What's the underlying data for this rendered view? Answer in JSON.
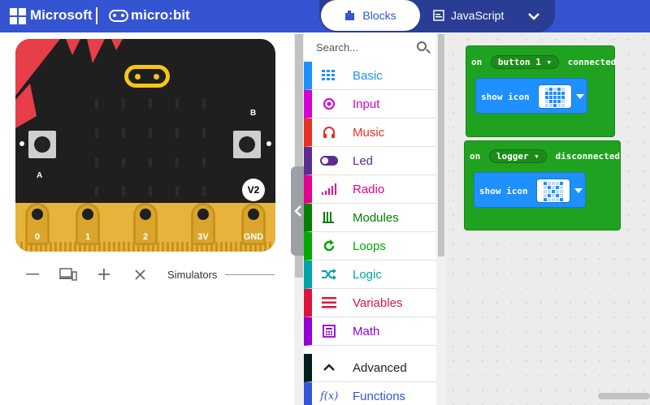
{
  "header": {
    "brand": "Microsoft",
    "product": "micro:bit",
    "tabs": {
      "blocks": "Blocks",
      "javascript": "JavaScript"
    }
  },
  "simulator": {
    "pins": [
      "0",
      "1",
      "2",
      "3V",
      "GND"
    ],
    "button_a": "A",
    "button_b": "B",
    "version_badge": "V2",
    "label": "Simulators"
  },
  "toolbox": {
    "search_placeholder": "Search...",
    "categories": [
      {
        "label": "Basic",
        "color": "#1E90FF",
        "icon": "grid-icon"
      },
      {
        "label": "Input",
        "color": "#D400D4",
        "icon": "target-icon"
      },
      {
        "label": "Music",
        "color": "#E63022",
        "icon": "headphones-icon"
      },
      {
        "label": "Led",
        "color": "#5C2D91",
        "icon": "toggle-icon"
      },
      {
        "label": "Radio",
        "color": "#E3008C",
        "icon": "signal-icon"
      },
      {
        "label": "Modules",
        "color": "#008000",
        "icon": "modules-icon"
      },
      {
        "label": "Loops",
        "color": "#00AA00",
        "icon": "loop-icon"
      },
      {
        "label": "Logic",
        "color": "#00A4A6",
        "icon": "shuffle-icon"
      },
      {
        "label": "Variables",
        "color": "#DC143C",
        "icon": "list-icon"
      },
      {
        "label": "Math",
        "color": "#9400D3",
        "icon": "calculator-icon"
      },
      {
        "label": "Advanced",
        "color": "#001E1E",
        "icon": "chevron-up-icon"
      },
      {
        "label": "Functions",
        "color": "#3455DB",
        "icon": "function-icon"
      }
    ]
  },
  "workspace": {
    "block1": {
      "on": "on",
      "param": "button 1",
      "event": "connected",
      "action": "show icon"
    },
    "block2": {
      "on": "on",
      "param": "logger",
      "event": "disconnected",
      "action": "show icon"
    }
  }
}
